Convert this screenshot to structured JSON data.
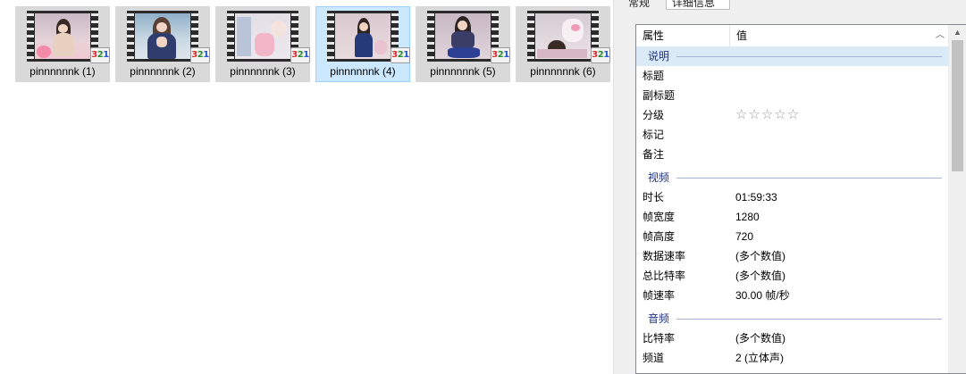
{
  "files": [
    {
      "name": "pinnnnnnk (1)",
      "selected": false
    },
    {
      "name": "pinnnnnnk (2)",
      "selected": false
    },
    {
      "name": "pinnnnnnk (3)",
      "selected": false
    },
    {
      "name": "pinnnnnnk (4)",
      "selected": true
    },
    {
      "name": "pinnnnnnk (5)",
      "selected": false
    },
    {
      "name": "pinnnnnnk (6)",
      "selected": false
    }
  ],
  "thumb_badge": {
    "d1": "3",
    "d2": "2",
    "d3": "1"
  },
  "tabs": {
    "general": "常规",
    "details": "详细信息"
  },
  "props": {
    "header_property": "属性",
    "header_value": "值",
    "groups": {
      "description": "说明",
      "video": "视频",
      "audio": "音频"
    },
    "description_rows": [
      {
        "k": "标题",
        "v": ""
      },
      {
        "k": "副标题",
        "v": ""
      },
      {
        "k": "分级",
        "v": ""
      },
      {
        "k": "标记",
        "v": ""
      },
      {
        "k": "备注",
        "v": ""
      }
    ],
    "rating_stars": "☆☆☆☆☆",
    "rating_value": 0,
    "video_rows": [
      {
        "k": "时长",
        "v": "01:59:33"
      },
      {
        "k": "帧宽度",
        "v": "1280"
      },
      {
        "k": "帧高度",
        "v": "720"
      },
      {
        "k": "数据速率",
        "v": "(多个数值)"
      },
      {
        "k": "总比特率",
        "v": "(多个数值)"
      },
      {
        "k": "帧速率",
        "v": "30.00 帧/秒"
      }
    ],
    "audio_rows": [
      {
        "k": "比特率",
        "v": "(多个数值)"
      },
      {
        "k": "频道",
        "v": "2 (立体声)"
      }
    ]
  },
  "colors": {
    "selection_bg": "#cce8ff",
    "selection_border": "#99d1ff",
    "group_text": "#1e3287",
    "group_sel_bg": "#dbeaf7"
  }
}
